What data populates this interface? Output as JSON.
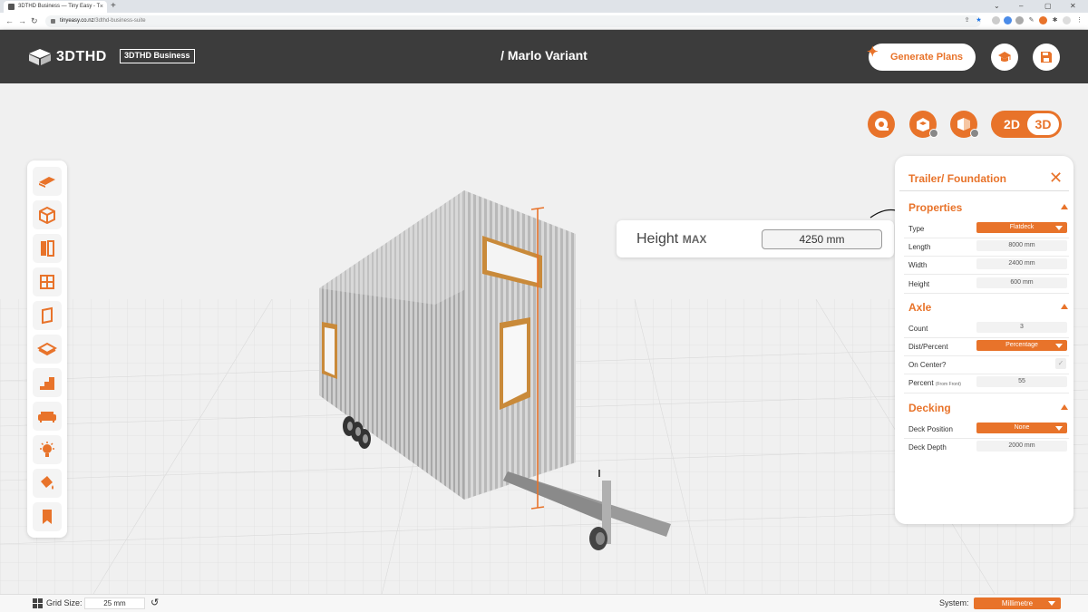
{
  "browser": {
    "tab_title": "3DTHD Business — Tiny Easy - T",
    "new_tab": "+",
    "url_domain": "tinyeasy.co.nz",
    "url_path": "/3dthd-business-suite"
  },
  "header": {
    "logo_text": "3DTHD",
    "badge": "3DTHD Business",
    "project_title": "/ Marlo Variant",
    "generate_plans": "Generate Plans"
  },
  "view_toggle": {
    "opt_2d": "2D",
    "opt_3d": "3D",
    "active": "3D"
  },
  "height_callout": {
    "label": "Height",
    "label_suffix": "MAX",
    "value": "4250 mm"
  },
  "panel": {
    "title": "Trailer/ Foundation",
    "close": "✕",
    "properties": {
      "heading": "Properties",
      "type_label": "Type",
      "type_value": "Flatdeck",
      "length_label": "Length",
      "length_value": "8000 mm",
      "width_label": "Width",
      "width_value": "2400 mm",
      "height_label": "Height",
      "height_value": "600 mm"
    },
    "axle": {
      "heading": "Axle",
      "count_label": "Count",
      "count_value": "3",
      "dist_label": "Dist/Percent",
      "dist_value": "Percentage",
      "on_center_label": "On Center?",
      "on_center_checked": true,
      "percent_label": "Percent",
      "percent_sub": "(From Front)",
      "percent_value": "55"
    },
    "decking": {
      "heading": "Decking",
      "position_label": "Deck Position",
      "position_value": "None",
      "depth_label": "Deck Depth",
      "depth_value": "2000 mm"
    }
  },
  "statusbar": {
    "grid_label": "Grid Size:",
    "grid_value": "25 mm",
    "system_label": "System:",
    "system_value": "Millimetre"
  },
  "colors": {
    "accent": "#e8732a",
    "header_bg": "#3c3c3c"
  }
}
